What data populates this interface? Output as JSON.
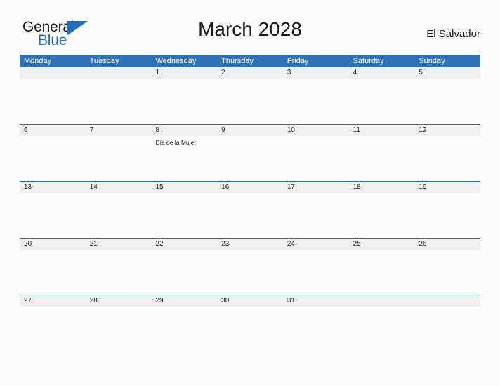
{
  "brand": {
    "line1": "General",
    "line2": "Blue",
    "triangle_icon": "triangle-icon",
    "color_dark": "#1b1b1b",
    "color_blue": "#2170b8"
  },
  "header": {
    "title": "March 2028",
    "country": "El Salvador"
  },
  "theme": {
    "header_blue": "#3072b3",
    "row_rule_blue": "#2e6da4",
    "band_gray": "#f0f0f0",
    "page_background": "#fcfcfc",
    "text": "#222222"
  },
  "calendar": {
    "month": "March",
    "year": "2028",
    "weekday_headers": [
      "Monday",
      "Tuesday",
      "Wednesday",
      "Thursday",
      "Friday",
      "Saturday",
      "Sunday"
    ],
    "weeks": [
      {
        "days": [
          {
            "number": "",
            "events": []
          },
          {
            "number": "",
            "events": []
          },
          {
            "number": "1",
            "events": []
          },
          {
            "number": "2",
            "events": []
          },
          {
            "number": "3",
            "events": []
          },
          {
            "number": "4",
            "events": []
          },
          {
            "number": "5",
            "events": []
          }
        ]
      },
      {
        "days": [
          {
            "number": "6",
            "events": []
          },
          {
            "number": "7",
            "events": []
          },
          {
            "number": "8",
            "events": [
              "Día de la Mujer"
            ]
          },
          {
            "number": "9",
            "events": []
          },
          {
            "number": "10",
            "events": []
          },
          {
            "number": "11",
            "events": []
          },
          {
            "number": "12",
            "events": []
          }
        ]
      },
      {
        "days": [
          {
            "number": "13",
            "events": []
          },
          {
            "number": "14",
            "events": []
          },
          {
            "number": "15",
            "events": []
          },
          {
            "number": "16",
            "events": []
          },
          {
            "number": "17",
            "events": []
          },
          {
            "number": "18",
            "events": []
          },
          {
            "number": "19",
            "events": []
          }
        ]
      },
      {
        "days": [
          {
            "number": "20",
            "events": []
          },
          {
            "number": "21",
            "events": []
          },
          {
            "number": "22",
            "events": []
          },
          {
            "number": "23",
            "events": []
          },
          {
            "number": "24",
            "events": []
          },
          {
            "number": "25",
            "events": []
          },
          {
            "number": "26",
            "events": []
          }
        ]
      },
      {
        "days": [
          {
            "number": "27",
            "events": []
          },
          {
            "number": "28",
            "events": []
          },
          {
            "number": "29",
            "events": []
          },
          {
            "number": "30",
            "events": []
          },
          {
            "number": "31",
            "events": []
          },
          {
            "number": "",
            "events": []
          },
          {
            "number": "",
            "events": []
          }
        ]
      }
    ]
  }
}
